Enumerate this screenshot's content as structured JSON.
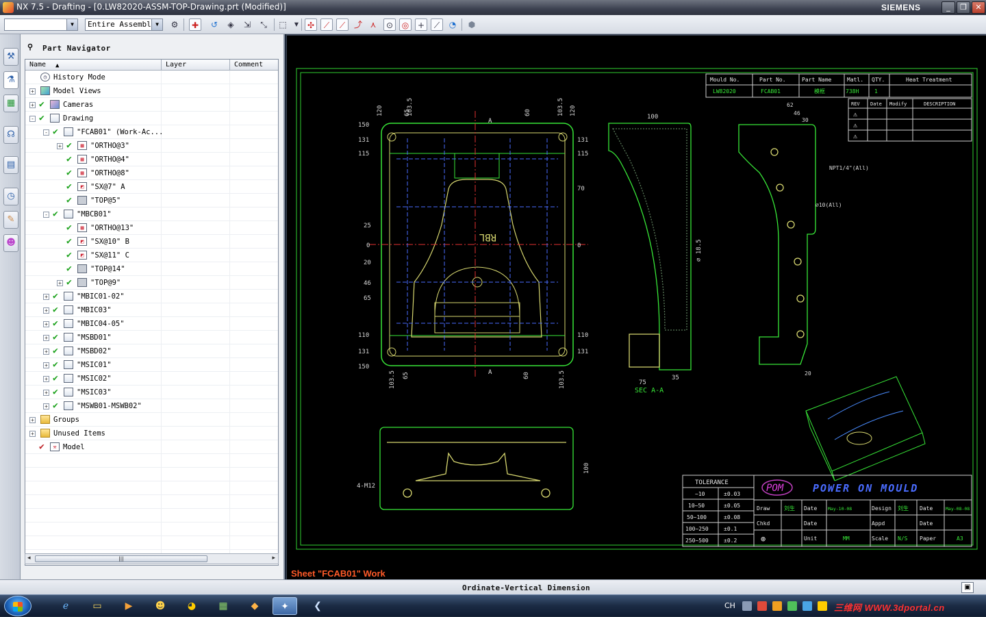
{
  "window": {
    "title": "NX 7.5 - Drafting - [0.LW82020-ASSM-TOP-Drawing.prt (Modified)]",
    "brand": "SIEMENS",
    "controls": [
      "_",
      "❐",
      "✕"
    ]
  },
  "toolbar": {
    "selection_filter": "",
    "scope": "Entire Assembly"
  },
  "navigator": {
    "title": "Part Navigator",
    "columns": [
      "Name",
      "Layer",
      "Comment"
    ],
    "rows": [
      {
        "label": "History Mode",
        "depth": 0,
        "expander": "",
        "check": "",
        "icon": "clock"
      },
      {
        "label": "Model Views",
        "depth": 0,
        "expander": "+",
        "check": "",
        "icon": "cube"
      },
      {
        "label": "Cameras",
        "depth": 0,
        "expander": "+",
        "check": "green",
        "icon": "cam"
      },
      {
        "label": "Drawing",
        "depth": 0,
        "expander": "-",
        "check": "green",
        "icon": "sheet"
      },
      {
        "label": "\"FCAB01\" (Work-Ac...",
        "depth": 1,
        "expander": "-",
        "check": "green",
        "icon": "sheet"
      },
      {
        "label": "\"ORTHO@3\"",
        "depth": 2,
        "expander": "+",
        "check": "green",
        "icon": "view"
      },
      {
        "label": "\"ORTHO@4\"",
        "depth": 2,
        "expander": "",
        "check": "green",
        "icon": "view"
      },
      {
        "label": "\"ORTHO@8\"",
        "depth": 2,
        "expander": "",
        "check": "green",
        "icon": "view"
      },
      {
        "label": "\"SX@7\" A",
        "depth": 2,
        "expander": "",
        "check": "green",
        "icon": "section"
      },
      {
        "label": "\"TOP@5\"",
        "depth": 2,
        "expander": "",
        "check": "green",
        "icon": "gray"
      },
      {
        "label": "\"MBCB01\"",
        "depth": 1,
        "expander": "-",
        "check": "green",
        "icon": "sheet"
      },
      {
        "label": "\"ORTHO@13\"",
        "depth": 2,
        "expander": "",
        "check": "green",
        "icon": "view"
      },
      {
        "label": "\"SX@10\" B",
        "depth": 2,
        "expander": "",
        "check": "green",
        "icon": "section"
      },
      {
        "label": "\"SX@11\" C",
        "depth": 2,
        "expander": "",
        "check": "green",
        "icon": "section"
      },
      {
        "label": "\"TOP@14\"",
        "depth": 2,
        "expander": "",
        "check": "green",
        "icon": "gray"
      },
      {
        "label": "\"TOP@9\"",
        "depth": 2,
        "expander": "+",
        "check": "green",
        "icon": "gray"
      },
      {
        "label": "\"MBIC01-02\"",
        "depth": 1,
        "expander": "+",
        "check": "green",
        "icon": "sheet"
      },
      {
        "label": "\"MBIC03\"",
        "depth": 1,
        "expander": "+",
        "check": "green",
        "icon": "sheet"
      },
      {
        "label": "\"MBIC04-05\"",
        "depth": 1,
        "expander": "+",
        "check": "green",
        "icon": "sheet"
      },
      {
        "label": "\"MSBD01\"",
        "depth": 1,
        "expander": "+",
        "check": "green",
        "icon": "sheet"
      },
      {
        "label": "\"MSBD02\"",
        "depth": 1,
        "expander": "+",
        "check": "green",
        "icon": "sheet"
      },
      {
        "label": "\"MSIC01\"",
        "depth": 1,
        "expander": "+",
        "check": "green",
        "icon": "sheet"
      },
      {
        "label": "\"MSIC02\"",
        "depth": 1,
        "expander": "+",
        "check": "green",
        "icon": "sheet"
      },
      {
        "label": "\"MSIC03\"",
        "depth": 1,
        "expander": "+",
        "check": "green",
        "icon": "sheet"
      },
      {
        "label": "\"MSWB01-MSWB02\"",
        "depth": 1,
        "expander": "+",
        "check": "green",
        "icon": "sheet"
      },
      {
        "label": "Groups",
        "depth": 0,
        "expander": "+",
        "check": "",
        "icon": "folder"
      },
      {
        "label": "Unused Items",
        "depth": 0,
        "expander": "+",
        "check": "",
        "icon": "folder"
      },
      {
        "label": "Model",
        "depth": 0,
        "expander": "",
        "check": "red",
        "icon": "model"
      }
    ]
  },
  "drawing": {
    "sheet_label": "Sheet \"FCAB01\" Work",
    "title_block": {
      "headers": [
        "Mould No.",
        "Part No.",
        "Part Name",
        "Matl.",
        "QTY.",
        "Heat Treatment"
      ],
      "values": [
        "LW82020",
        "FCAB01",
        "模框",
        "738H",
        "1",
        ""
      ],
      "rev_headers": [
        "REV",
        "Date",
        "Modify",
        "DESCRIPTION"
      ]
    },
    "tolerance": {
      "title": "TOLERANCE",
      "rows": [
        [
          "~10",
          "±0.03"
        ],
        [
          "10~50",
          "±0.05"
        ],
        [
          "50~100",
          "±0.08"
        ],
        [
          "100~250",
          "±0.1"
        ],
        [
          "250~500",
          "±0.2"
        ]
      ]
    },
    "company": {
      "logo": "POM",
      "name": "POWER ON MOULD"
    },
    "sign_block": {
      "draw": "Draw",
      "draw_name": "刘生",
      "date": "Date",
      "draw_date": "May-10-08",
      "design": "Design",
      "design_name": "刘生",
      "design_date": "May-08-08",
      "chkd": "Chkd",
      "appd": "Appd",
      "unit": "Unit",
      "unit_value": "MM",
      "scale": "Scale",
      "scale_value": "N/S",
      "paper": "Paper",
      "paper_value": "A3"
    },
    "dims_left": [
      "150",
      "131",
      "115",
      "25",
      "0",
      "20",
      "46",
      "65",
      "110",
      "131",
      "150"
    ],
    "dims_right": [
      "131",
      "115",
      "70",
      "0",
      "110",
      "131"
    ],
    "dims_top": [
      "120",
      "103.5",
      "65",
      "60",
      "103.5",
      "120"
    ],
    "dims_bottom": [
      "103.5",
      "65",
      "60",
      "103.5"
    ],
    "section_mark": "A",
    "section_label": "SEC A-A",
    "sec_dims": [
      "100",
      "75",
      "35",
      "⌀ 18.5"
    ],
    "side_dims": [
      "62",
      "46",
      "30",
      "20"
    ],
    "notes": [
      "NPT1/4\"(All)",
      "⌀10(All)",
      "4-M12"
    ],
    "front_dim": "100",
    "part_text": [
      "RBL",
      "Ad"
    ]
  },
  "status": {
    "text": "Ordinate-Vertical Dimension"
  },
  "taskbar": {
    "lang": "CH",
    "watermark": "三维网 WWW.3dportal.cn"
  }
}
